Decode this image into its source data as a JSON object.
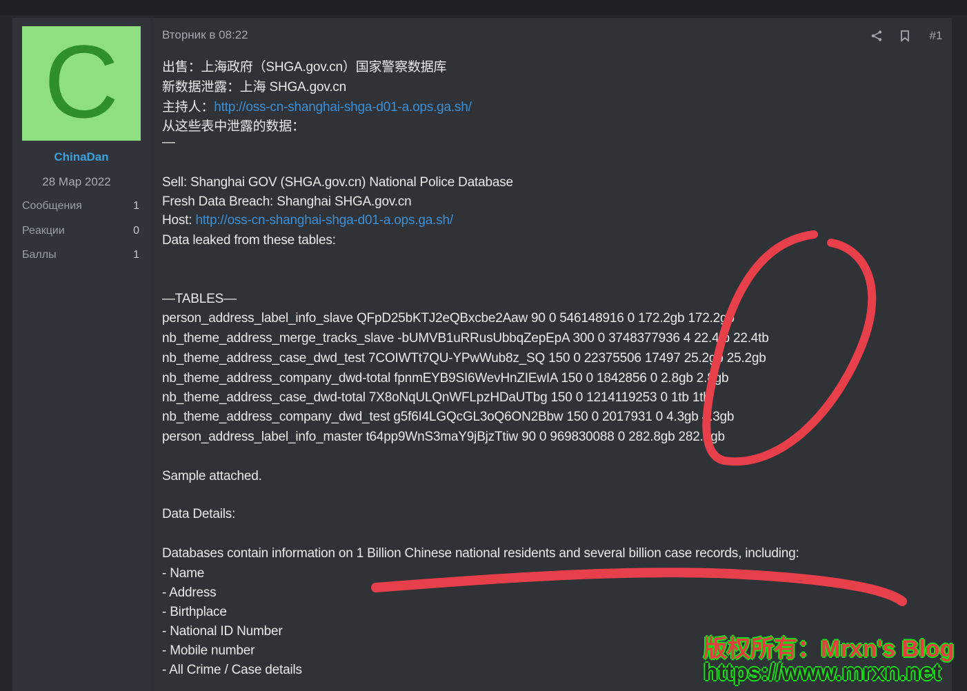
{
  "post": {
    "timestamp": "Вторник в 08:22",
    "number": "#1",
    "lines_cn": [
      "出售：上海政府（SHGA.gov.cn）国家警察数据库",
      "新数据泄露：上海 SHGA.gov.cn",
      "主持人：",
      "从这些表中泄露的数据："
    ],
    "host_link_cn": "http://oss-cn-shanghai-shga-d01-a.ops.ga.sh/",
    "divider": "—",
    "lines_en": [
      "Sell: Shanghai GOV (SHGA.gov.cn) National Police Database",
      "Fresh Data Breach: Shanghai SHGA.gov.cn",
      "Host: ",
      "Data leaked from these tables:"
    ],
    "host_link_en": "http://oss-cn-shanghai-shga-d01-a.ops.ga.sh/",
    "tables_header": "—TABLES—",
    "tables": [
      "person_address_label_info_slave QFpD25bKTJ2eQBxcbe2Aaw 90 0 546148916 0 172.2gb 172.2gb",
      "nb_theme_address_merge_tracks_slave -bUMVB1uRRusUbbqZepEpA 300 0 3748377936 4 22.4tb 22.4tb",
      "nb_theme_address_case_dwd_test 7COIWTt7QU-YPwWub8z_SQ 150 0 22375506 17497 25.2gb 25.2gb",
      "nb_theme_address_company_dwd-total fpnmEYB9SI6WevHnZIEwIA 150 0 1842856 0 2.8gb 2.8gb",
      "nb_theme_address_case_dwd-total 7X8oNqULQnWFLpzHDaUTbg 150 0 1214119253 0 1tb 1tb",
      "nb_theme_address_company_dwd_test g5f6I4LGQcGL3oQ6ON2Bbw 150 0 2017931 0 4.3gb 4.3gb",
      "person_address_label_info_master t64pp9WnS3maY9jBjzTtiw 90 0 969830088 0 282.8gb 282.8gb"
    ],
    "sample": "Sample attached.",
    "details_header": "Data Details:",
    "details_intro": "Databases contain information on 1 Billion Chinese national residents and several billion case records, including:",
    "details_items": [
      "- Name",
      "- Address",
      "- Birthplace",
      "- National ID Number",
      "- Mobile number",
      "- All Crime / Case details"
    ]
  },
  "author": {
    "avatar_letter": "C",
    "username": "ChinaDan",
    "join_date": "28 Мар 2022",
    "stats": [
      {
        "label": "Сообщения",
        "value": "1"
      },
      {
        "label": "Реакции",
        "value": "0"
      },
      {
        "label": "Баллы",
        "value": "1"
      }
    ]
  },
  "watermark": {
    "line1": "版权所有：Mrxn's Blog",
    "line2": "https://www.mrxn.net"
  },
  "colors": {
    "avatar_bg": "#8fde7f",
    "avatar_letter": "#2f8f2c",
    "link": "#3d8fd4",
    "annotation": "#e8404a"
  }
}
